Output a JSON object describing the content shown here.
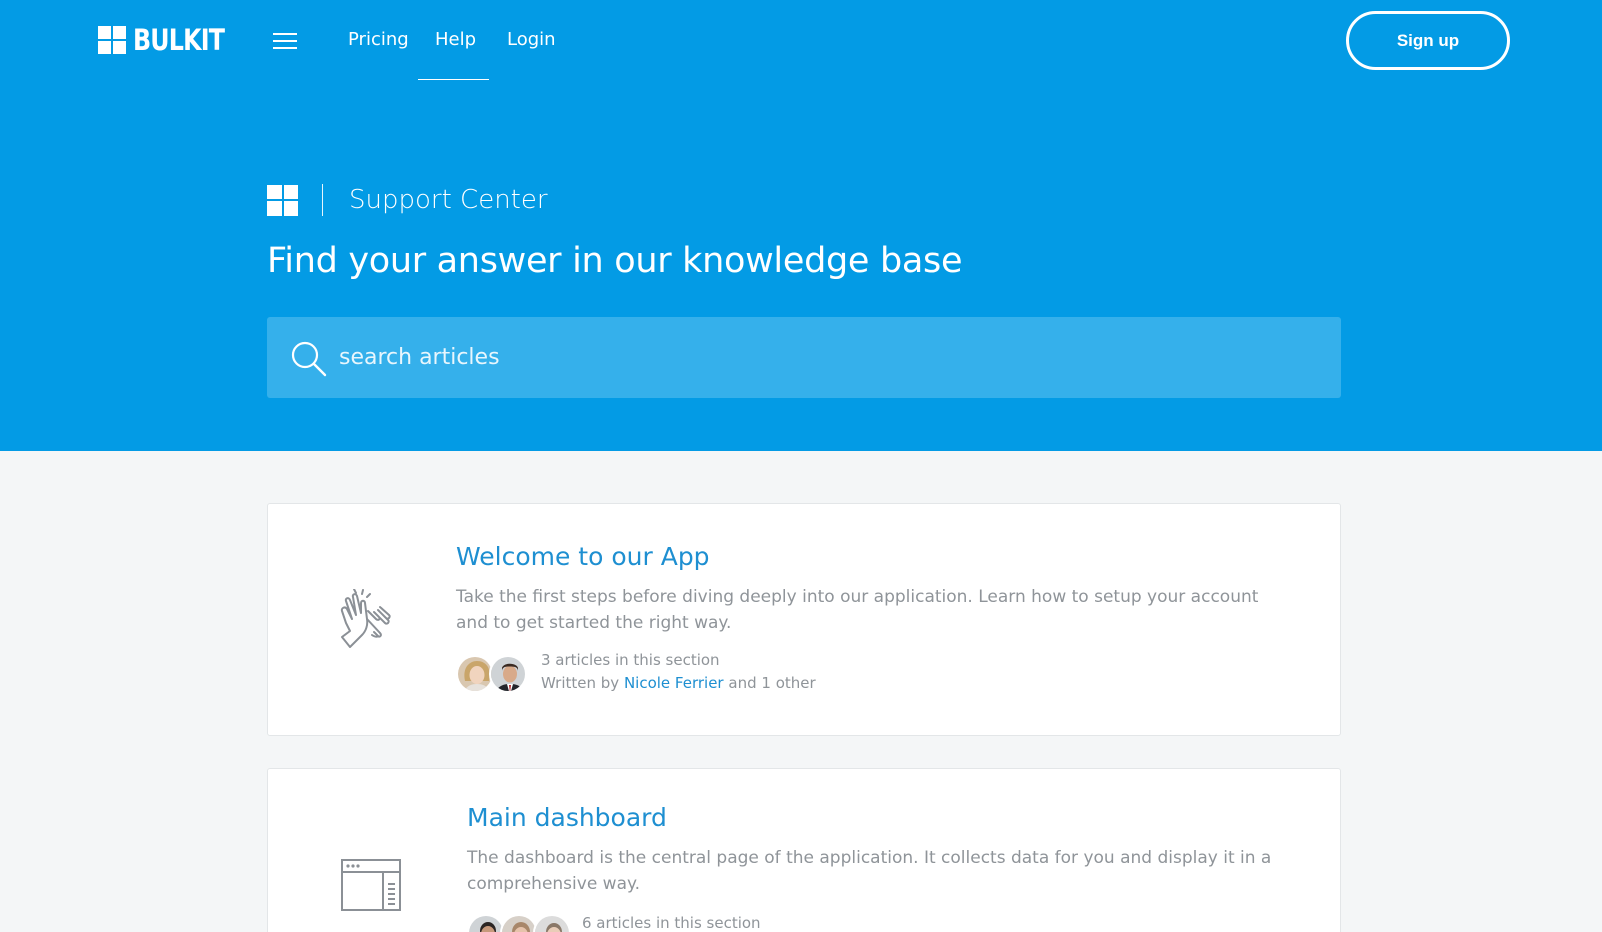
{
  "navbar": {
    "brand": "BULKIT",
    "links": [
      {
        "label": "Pricing",
        "active": false
      },
      {
        "label": "Help",
        "active": true
      },
      {
        "label": "Login",
        "active": false
      }
    ],
    "signup_label": "Sign up"
  },
  "hero": {
    "section_label": "Support Center",
    "title": "Find your answer in our knowledge base",
    "search_placeholder": "search articles"
  },
  "colors": {
    "hero_bg": "#039be5",
    "search_bg": "#35b0eb",
    "page_bg": "#f4f6f7",
    "link": "#1e8fd1"
  },
  "sections": [
    {
      "icon": "clapping-hands-icon",
      "title": "Welcome to our App",
      "description": "Take the first steps before diving deeply into our application. Learn how to setup your account and to get started the right way.",
      "articles_count": "3 articles in this section",
      "written_by_prefix": "Written by",
      "author": "Nicole Ferrier",
      "written_by_suffix": "and 1 other"
    },
    {
      "icon": "dashboard-window-icon",
      "title": "Main dashboard",
      "description": "The dashboard is the central page of the application. It collects data for you and display it in a comprehensive way.",
      "articles_count": "6 articles in this section"
    }
  ]
}
